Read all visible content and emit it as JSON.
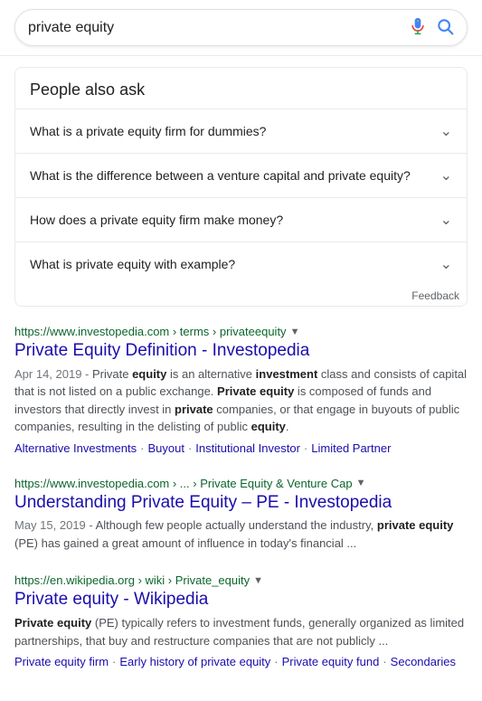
{
  "search": {
    "query": "private equity",
    "placeholder": "Search"
  },
  "paa": {
    "title": "People also ask",
    "questions": [
      "What is a private equity firm for dummies?",
      "What is the difference between a venture capital and private equity?",
      "How does a private equity firm make money?",
      "What is private equity with example?"
    ],
    "feedback": "Feedback"
  },
  "results": [
    {
      "title": "Private Equity Definition - Investopedia",
      "url": "https://www.investopedia.com › terms › privateequity",
      "url_display": "https://www.investopedia.com",
      "url_path": "› terms › privateequity",
      "date": "Apr 14, 2019",
      "snippet_html": "Private <b>equity</b> is an alternative <b>investment</b> class and consists of capital that is not listed on a public exchange. <b>Private equity</b> is composed of funds and investors that directly invest in <b>private</b> companies, or that engage in buyouts of public companies, resulting in the delisting of public <b>equity</b>.",
      "tags": [
        "Alternative Investments",
        "Buyout",
        "Institutional Investor",
        "Limited Partner"
      ]
    },
    {
      "title": "Understanding Private Equity – PE - Investopedia",
      "url": "https://www.investopedia.com › ... › Private Equity & Venture Cap",
      "url_display": "https://www.investopedia.com",
      "url_path": "› ... › Private Equity & Venture Cap",
      "date": "May 15, 2019",
      "snippet_html": "Although few people actually understand the industry, <b>private equity</b> (PE) has gained a great amount of influence in today's financial ...",
      "tags": []
    },
    {
      "title": "Private equity - Wikipedia",
      "url": "https://en.wikipedia.org › wiki › Private_equity",
      "url_display": "https://en.wikipedia.org",
      "url_path": "› wiki › Private_equity",
      "date": "",
      "snippet_html": "<b>Private equity</b> (PE) typically refers to investment funds, generally organized as limited partnerships, that buy and restructure companies that are not publicly ...",
      "tags": [
        "Private equity firm",
        "Early history of private equity",
        "Private equity fund",
        "Secondaries"
      ]
    }
  ]
}
